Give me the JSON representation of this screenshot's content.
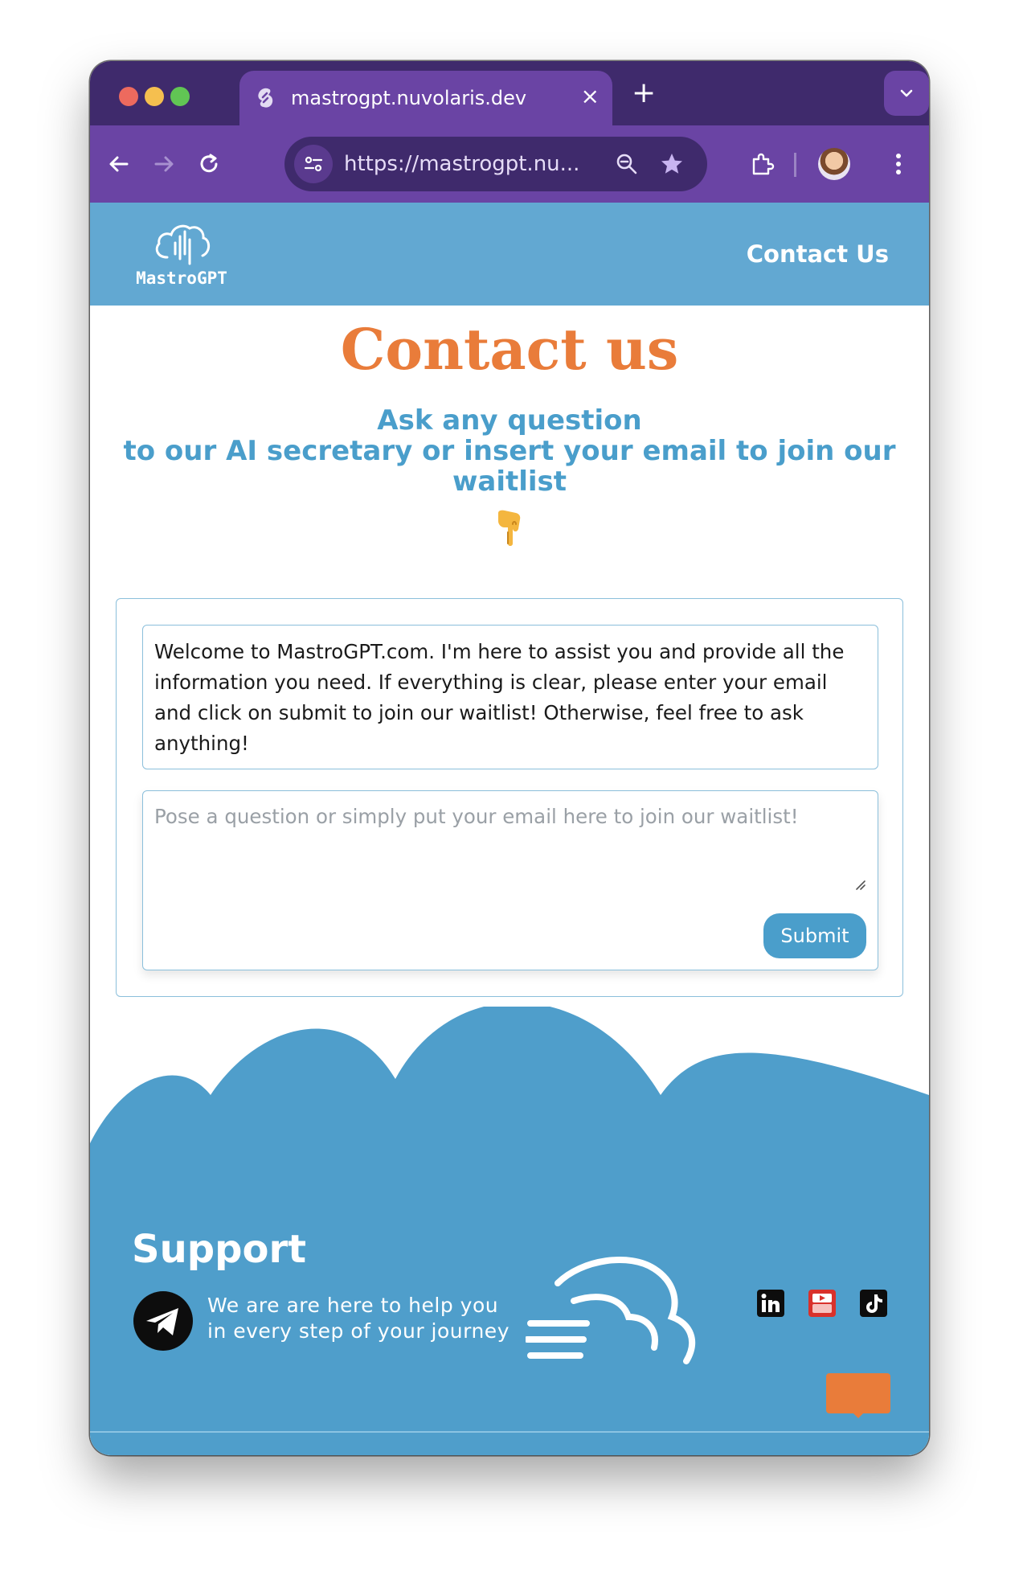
{
  "browser": {
    "tab_title": "mastrogpt.nuvolaris.dev",
    "tab_close": "×",
    "new_tab": "+",
    "url": "https://mastrogpt.nu..."
  },
  "header": {
    "logo_text": "MastroGPT",
    "nav_contact": "Contact Us"
  },
  "main": {
    "title": "Contact us",
    "subtitle_line1": "Ask any question",
    "subtitle_line2": "to our AI secretary or insert your email to join our waitlist"
  },
  "chat": {
    "welcome_message": "Welcome to MastroGPT.com. I'm here to assist you and provide all the information you need. If everything is clear, please enter your email and click on submit to join our waitlist! Otherwise, feel free to ask anything!",
    "input_placeholder": "Pose a question or simply put your email here to join our waitlist!",
    "submit_label": "Submit"
  },
  "footer": {
    "support_title": "Support",
    "support_line1": "We are are here to help you",
    "support_line2": "in every step of your journey",
    "social_icons": [
      "linkedin-icon",
      "youtube-icon",
      "tiktok-icon"
    ]
  },
  "colors": {
    "chrome_dark": "#3f2a6c",
    "chrome_tab": "#6a44a4",
    "header_blue": "#62a8d2",
    "accent_blue": "#4a9ecb",
    "title_orange": "#e97c3a",
    "footer_blue": "#4f9ecb"
  }
}
